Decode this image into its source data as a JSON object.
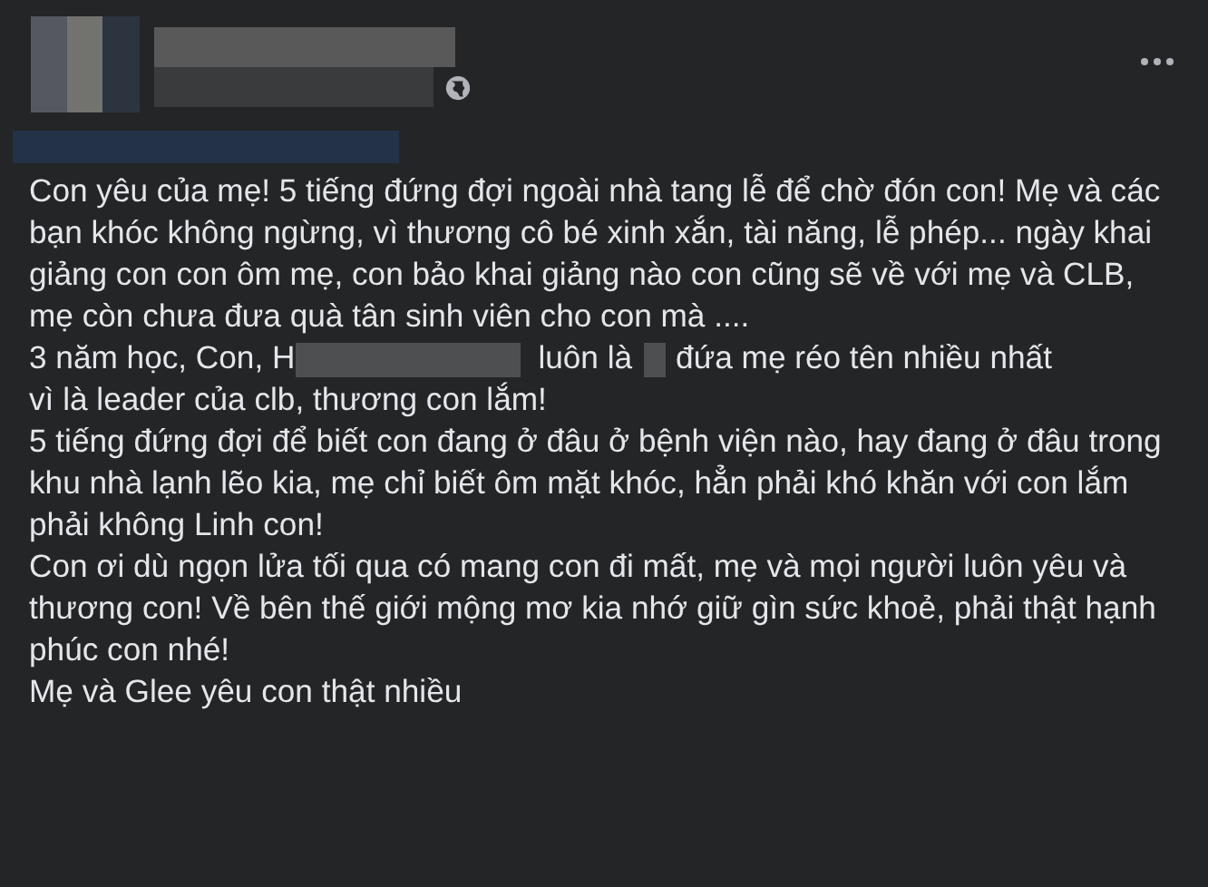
{
  "post": {
    "paragraphs": [
      {
        "segments": [
          {
            "kind": "text",
            "text": "Con yêu của mẹ! 5 tiếng đứng đợi ngoài nhà tang lễ để chờ đón con! Mẹ và các bạn khóc không ngừng, vì thương cô bé xinh xắn, tài năng, lễ phép... ngày khai giảng con con ôm mẹ, con bảo khai giảng nào con cũng sẽ về với mẹ và CLB, mẹ còn chưa đưa quà tân sinh viên cho con mà ...."
          }
        ]
      },
      {
        "segments": [
          {
            "kind": "text",
            "text": "3 năm học, Con, H"
          },
          {
            "kind": "redacted"
          },
          {
            "kind": "text",
            "text": "luôn là"
          },
          {
            "kind": "redacted_short"
          },
          {
            "kind": "text",
            "text": "đứa mẹ réo tên nhiều nhất"
          },
          {
            "kind": "break"
          },
          {
            "kind": "text",
            "text": "vì là leader của clb, thương con lắm!"
          }
        ]
      },
      {
        "segments": [
          {
            "kind": "text",
            "text": "5 tiếng đứng đợi để biết con đang ở đâu ở bệnh viện nào, hay đang ở đâu trong khu nhà lạnh lẽo kia, mẹ chỉ biết ôm mặt khóc, hẳn phải khó khăn với con lắm phải không Linh con!"
          }
        ]
      },
      {
        "segments": [
          {
            "kind": "text",
            "text": "Con ơi dù ngọn lửa tối qua có mang con đi mất, mẹ và mọi người luôn yêu và thương con! Về bên thế giới mộng mơ kia nhớ giữ gìn sức khoẻ, phải thật hạnh phúc con nhé!"
          }
        ]
      },
      {
        "segments": [
          {
            "kind": "text",
            "text": "Mẹ và Glee yêu con thật nhiều"
          }
        ]
      }
    ]
  }
}
